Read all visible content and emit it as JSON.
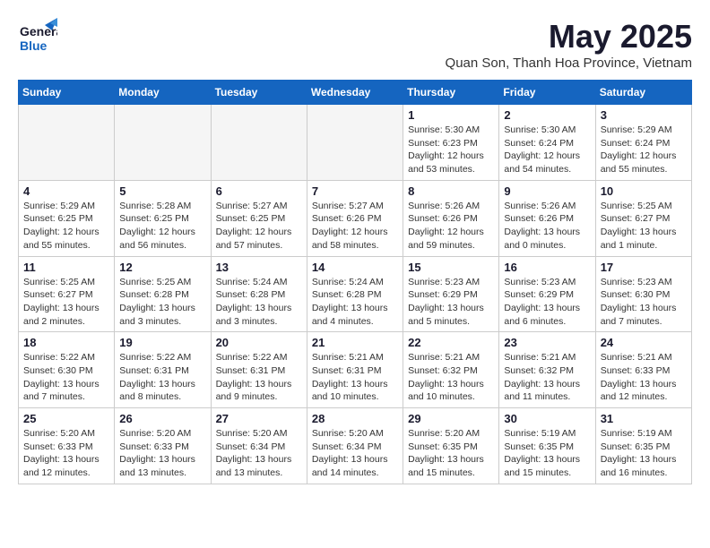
{
  "header": {
    "logo_line1": "General",
    "logo_line2": "Blue",
    "title": "May 2025",
    "subtitle": "Quan Son, Thanh Hoa Province, Vietnam"
  },
  "weekdays": [
    "Sunday",
    "Monday",
    "Tuesday",
    "Wednesday",
    "Thursday",
    "Friday",
    "Saturday"
  ],
  "weeks": [
    [
      {
        "day": "",
        "detail": ""
      },
      {
        "day": "",
        "detail": ""
      },
      {
        "day": "",
        "detail": ""
      },
      {
        "day": "",
        "detail": ""
      },
      {
        "day": "1",
        "detail": "Sunrise: 5:30 AM\nSunset: 6:23 PM\nDaylight: 12 hours\nand 53 minutes."
      },
      {
        "day": "2",
        "detail": "Sunrise: 5:30 AM\nSunset: 6:24 PM\nDaylight: 12 hours\nand 54 minutes."
      },
      {
        "day": "3",
        "detail": "Sunrise: 5:29 AM\nSunset: 6:24 PM\nDaylight: 12 hours\nand 55 minutes."
      }
    ],
    [
      {
        "day": "4",
        "detail": "Sunrise: 5:29 AM\nSunset: 6:25 PM\nDaylight: 12 hours\nand 55 minutes."
      },
      {
        "day": "5",
        "detail": "Sunrise: 5:28 AM\nSunset: 6:25 PM\nDaylight: 12 hours\nand 56 minutes."
      },
      {
        "day": "6",
        "detail": "Sunrise: 5:27 AM\nSunset: 6:25 PM\nDaylight: 12 hours\nand 57 minutes."
      },
      {
        "day": "7",
        "detail": "Sunrise: 5:27 AM\nSunset: 6:26 PM\nDaylight: 12 hours\nand 58 minutes."
      },
      {
        "day": "8",
        "detail": "Sunrise: 5:26 AM\nSunset: 6:26 PM\nDaylight: 12 hours\nand 59 minutes."
      },
      {
        "day": "9",
        "detail": "Sunrise: 5:26 AM\nSunset: 6:26 PM\nDaylight: 13 hours\nand 0 minutes."
      },
      {
        "day": "10",
        "detail": "Sunrise: 5:25 AM\nSunset: 6:27 PM\nDaylight: 13 hours\nand 1 minute."
      }
    ],
    [
      {
        "day": "11",
        "detail": "Sunrise: 5:25 AM\nSunset: 6:27 PM\nDaylight: 13 hours\nand 2 minutes."
      },
      {
        "day": "12",
        "detail": "Sunrise: 5:25 AM\nSunset: 6:28 PM\nDaylight: 13 hours\nand 3 minutes."
      },
      {
        "day": "13",
        "detail": "Sunrise: 5:24 AM\nSunset: 6:28 PM\nDaylight: 13 hours\nand 3 minutes."
      },
      {
        "day": "14",
        "detail": "Sunrise: 5:24 AM\nSunset: 6:28 PM\nDaylight: 13 hours\nand 4 minutes."
      },
      {
        "day": "15",
        "detail": "Sunrise: 5:23 AM\nSunset: 6:29 PM\nDaylight: 13 hours\nand 5 minutes."
      },
      {
        "day": "16",
        "detail": "Sunrise: 5:23 AM\nSunset: 6:29 PM\nDaylight: 13 hours\nand 6 minutes."
      },
      {
        "day": "17",
        "detail": "Sunrise: 5:23 AM\nSunset: 6:30 PM\nDaylight: 13 hours\nand 7 minutes."
      }
    ],
    [
      {
        "day": "18",
        "detail": "Sunrise: 5:22 AM\nSunset: 6:30 PM\nDaylight: 13 hours\nand 7 minutes."
      },
      {
        "day": "19",
        "detail": "Sunrise: 5:22 AM\nSunset: 6:31 PM\nDaylight: 13 hours\nand 8 minutes."
      },
      {
        "day": "20",
        "detail": "Sunrise: 5:22 AM\nSunset: 6:31 PM\nDaylight: 13 hours\nand 9 minutes."
      },
      {
        "day": "21",
        "detail": "Sunrise: 5:21 AM\nSunset: 6:31 PM\nDaylight: 13 hours\nand 10 minutes."
      },
      {
        "day": "22",
        "detail": "Sunrise: 5:21 AM\nSunset: 6:32 PM\nDaylight: 13 hours\nand 10 minutes."
      },
      {
        "day": "23",
        "detail": "Sunrise: 5:21 AM\nSunset: 6:32 PM\nDaylight: 13 hours\nand 11 minutes."
      },
      {
        "day": "24",
        "detail": "Sunrise: 5:21 AM\nSunset: 6:33 PM\nDaylight: 13 hours\nand 12 minutes."
      }
    ],
    [
      {
        "day": "25",
        "detail": "Sunrise: 5:20 AM\nSunset: 6:33 PM\nDaylight: 13 hours\nand 12 minutes."
      },
      {
        "day": "26",
        "detail": "Sunrise: 5:20 AM\nSunset: 6:33 PM\nDaylight: 13 hours\nand 13 minutes."
      },
      {
        "day": "27",
        "detail": "Sunrise: 5:20 AM\nSunset: 6:34 PM\nDaylight: 13 hours\nand 13 minutes."
      },
      {
        "day": "28",
        "detail": "Sunrise: 5:20 AM\nSunset: 6:34 PM\nDaylight: 13 hours\nand 14 minutes."
      },
      {
        "day": "29",
        "detail": "Sunrise: 5:20 AM\nSunset: 6:35 PM\nDaylight: 13 hours\nand 15 minutes."
      },
      {
        "day": "30",
        "detail": "Sunrise: 5:19 AM\nSunset: 6:35 PM\nDaylight: 13 hours\nand 15 minutes."
      },
      {
        "day": "31",
        "detail": "Sunrise: 5:19 AM\nSunset: 6:35 PM\nDaylight: 13 hours\nand 16 minutes."
      }
    ]
  ]
}
